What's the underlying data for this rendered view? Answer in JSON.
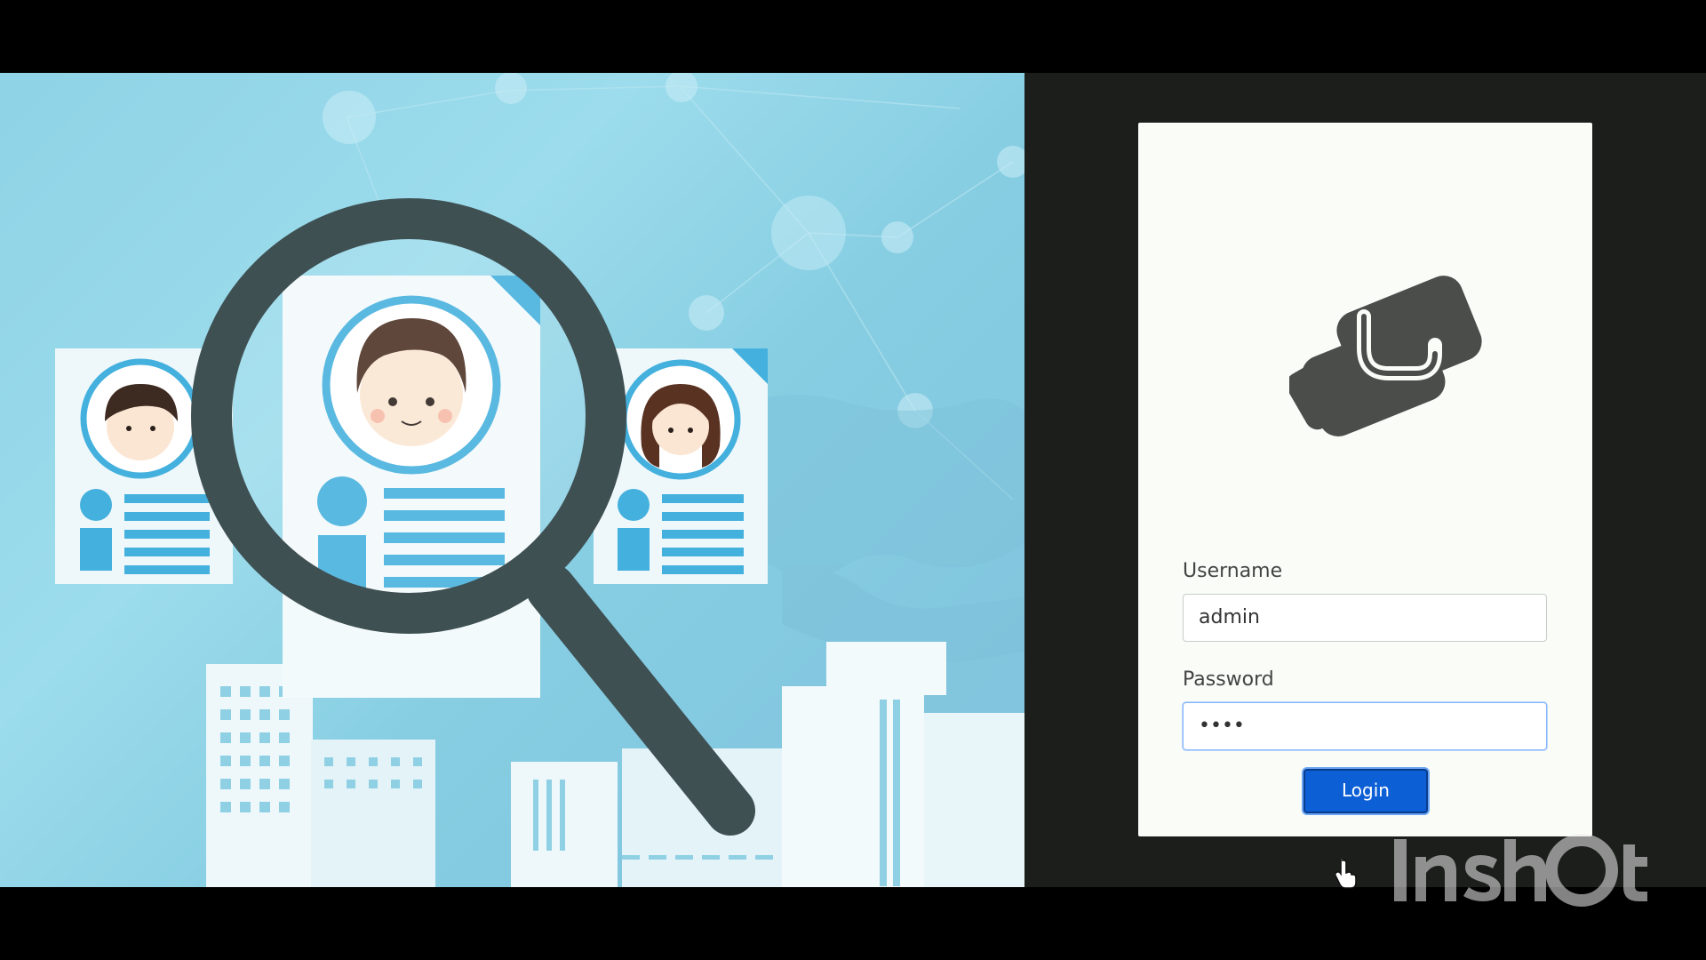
{
  "login": {
    "username_label": "Username",
    "username_value": "admin",
    "password_label": "Password",
    "password_value": "••••",
    "submit_label": "Login"
  },
  "colors": {
    "hero_background": "#8ed3e6",
    "frame_background": "#1b1e1b",
    "card_background": "#fafcf8",
    "logo_color": "#4b4d4b",
    "button_color": "#0d5fd6",
    "magnifier_color": "#3f5053"
  },
  "icons": {
    "logo": "handshake-icon",
    "cursor": "hand-pointer-icon"
  }
}
